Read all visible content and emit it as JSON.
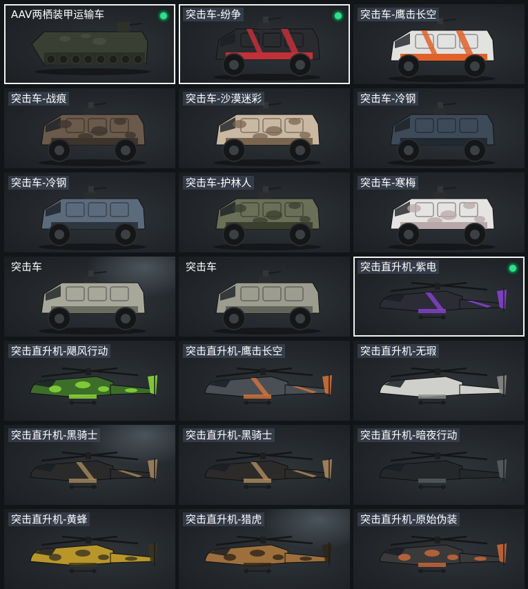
{
  "items": [
    {
      "label": "AAV两栖装甲运输车",
      "type": "amphib",
      "selected": true,
      "equipped": true,
      "tinted": false,
      "body": "#3a3f33",
      "accent": "#2a2e25",
      "pattern": "none"
    },
    {
      "label": "突击车-纷争",
      "type": "truck",
      "selected": true,
      "equipped": true,
      "tinted": true,
      "body": "#2a2b2f",
      "accent": "#c2303a",
      "pattern": "stripes"
    },
    {
      "label": "突击车-鹰击长空",
      "type": "truck",
      "selected": false,
      "equipped": false,
      "tinted": true,
      "body": "#e2e2e0",
      "accent": "#e0622a",
      "pattern": "stripes"
    },
    {
      "label": "突击车-战痕",
      "type": "truck",
      "selected": false,
      "equipped": false,
      "tinted": true,
      "body": "#6a5a4c",
      "accent": "#3d342c",
      "pattern": "camo"
    },
    {
      "label": "突击车-沙漠迷彩",
      "type": "truck",
      "selected": false,
      "equipped": false,
      "tinted": true,
      "body": "#c9b8a2",
      "accent": "#7a6650",
      "pattern": "camo"
    },
    {
      "label": "突击车-冷钢",
      "type": "truck",
      "selected": false,
      "equipped": false,
      "tinted": true,
      "body": "#3d4a58",
      "accent": "#222931",
      "pattern": "none"
    },
    {
      "label": "突击车-冷钢",
      "type": "truck",
      "selected": false,
      "equipped": false,
      "tinted": true,
      "body": "#5c6b7c",
      "accent": "#2e3640",
      "pattern": "none"
    },
    {
      "label": "突击车-护林人",
      "type": "truck",
      "selected": false,
      "equipped": false,
      "tinted": true,
      "body": "#6a7058",
      "accent": "#3b3f2f",
      "pattern": "camo"
    },
    {
      "label": "突击车-寒梅",
      "type": "truck",
      "selected": false,
      "equipped": false,
      "tinted": true,
      "body": "#e6e4e2",
      "accent": "#b8a8aa",
      "pattern": "camo"
    },
    {
      "label": "突击车",
      "type": "truck",
      "selected": false,
      "equipped": false,
      "tinted": false,
      "body": "#a7a89a",
      "accent": "#6b6c60",
      "pattern": "none"
    },
    {
      "label": "突击车",
      "type": "truck",
      "selected": false,
      "equipped": false,
      "tinted": false,
      "body": "#9c9d8f",
      "accent": "#64655a",
      "pattern": "none"
    },
    {
      "label": "突击直升机-紫电",
      "type": "heli",
      "selected": true,
      "equipped": true,
      "tinted": true,
      "body": "#2c2c36",
      "accent": "#8a44d6",
      "pattern": "stripes"
    },
    {
      "label": "突击直升机-飓风行动",
      "type": "heli",
      "selected": false,
      "equipped": false,
      "tinted": true,
      "body": "#3c6e2a",
      "accent": "#8fe03a",
      "pattern": "camo"
    },
    {
      "label": "突击直升机-鹰击长空",
      "type": "heli",
      "selected": false,
      "equipped": false,
      "tinted": true,
      "body": "#4a4f56",
      "accent": "#d8743a",
      "pattern": "stripes"
    },
    {
      "label": "突击直升机-无瑕",
      "type": "heli",
      "selected": false,
      "equipped": false,
      "tinted": true,
      "body": "#cfcfcb",
      "accent": "#8e8e8a",
      "pattern": "none"
    },
    {
      "label": "突击直升机-黑骑士",
      "type": "heli",
      "selected": false,
      "equipped": false,
      "tinted": true,
      "body": "#2a2a2a",
      "accent": "#a88a5e",
      "pattern": "stripes"
    },
    {
      "label": "突击直升机-黑骑士",
      "type": "heli",
      "selected": false,
      "equipped": false,
      "tinted": true,
      "body": "#2c2b29",
      "accent": "#b08d60",
      "pattern": "stripes"
    },
    {
      "label": "突击直升机-暗夜行动",
      "type": "heli",
      "selected": false,
      "equipped": false,
      "tinted": true,
      "body": "#25282b",
      "accent": "#5a5f63",
      "pattern": "none"
    },
    {
      "label": "突击直升机-黄蜂",
      "type": "heli",
      "selected": false,
      "equipped": false,
      "tinted": true,
      "body": "#b8962a",
      "accent": "#3a3520",
      "pattern": "camo"
    },
    {
      "label": "突击直升机-猎虎",
      "type": "heli",
      "selected": false,
      "equipped": false,
      "tinted": true,
      "body": "#9c6f3c",
      "accent": "#2f2418",
      "pattern": "camo"
    },
    {
      "label": "突击直升机-原始伪装",
      "type": "heli",
      "selected": false,
      "equipped": false,
      "tinted": true,
      "body": "#3a3a3a",
      "accent": "#d06a3a",
      "pattern": "camo"
    }
  ]
}
